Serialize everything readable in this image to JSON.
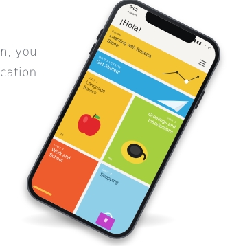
{
  "background": {
    "line1": "n, you",
    "line2": "cation",
    "line3": ""
  },
  "status_bar": {
    "time": "3:02",
    "back": "◂ Search",
    "icons": "▮▮▮ ◔ ▭"
  },
  "app": {
    "title": "¡Hola!",
    "menu_icon": "hamburger-menu-icon"
  },
  "cards": {
    "guide": {
      "kicker": "GUIDE",
      "title": "Learning with Rosetta Stone",
      "color": "#f3c532"
    },
    "intro": {
      "kicker": "INTRO LESSON",
      "title": "Get Started!",
      "color": "#2fa7dd"
    },
    "unit1": {
      "kicker": "UNIT 1",
      "title": "Language Basics",
      "progress": "0%",
      "color": "#f5c02f",
      "icon": "apple-icon"
    },
    "unit2": {
      "kicker": "UNIT 2",
      "title": "Greetings and Introductions",
      "progress": "0%",
      "color": "#a6cf3f",
      "icon": "coffee-cup-icon"
    },
    "unit3": {
      "kicker": "UNIT 3",
      "title": "Work and School",
      "color": "#ee5b2c"
    },
    "unit4": {
      "kicker": "UNIT 4",
      "title": "Shopping",
      "color": "#8fd0e8"
    }
  }
}
